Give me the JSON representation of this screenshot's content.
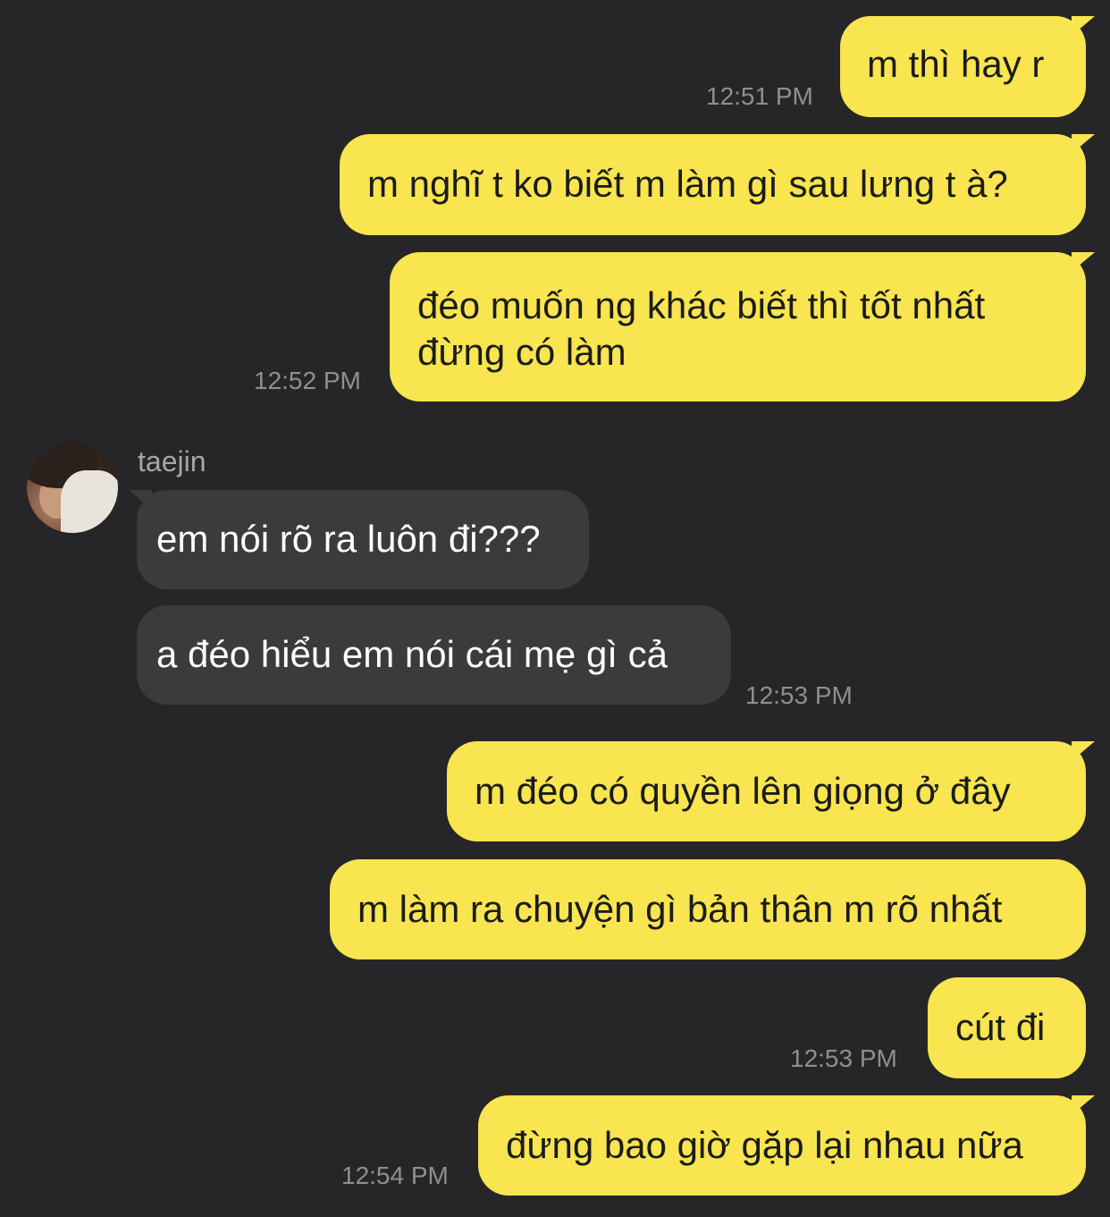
{
  "messages": [
    {
      "text": "m thì hay r",
      "time": "12:51 PM"
    },
    {
      "text": "m nghĩ t ko biết m làm gì sau lưng t à?"
    },
    {
      "line1": "đéo muốn ng khác biết thì tốt nhất",
      "line2": "đừng có làm",
      "time": "12:52 PM"
    },
    {
      "sender": "taejin",
      "text": "em nói rõ ra luôn đi???"
    },
    {
      "text": "a đéo hiểu em nói cái mẹ gì cả",
      "time": "12:53 PM"
    },
    {
      "text": "m đéo có quyền lên giọng ở đây"
    },
    {
      "text": "m làm ra chuyện gì bản thân m rõ nhất"
    },
    {
      "text": "cút đi",
      "time": "12:53 PM"
    },
    {
      "text": "đừng bao giờ gặp lại nhau nữa",
      "time": "12:54 PM"
    }
  ],
  "colors": {
    "background": "#262628",
    "outgoing_bubble": "#f8e54f",
    "incoming_bubble": "#3b3b3d",
    "timestamp": "#8f8f93"
  },
  "avatar_icon": "user-avatar-photo"
}
